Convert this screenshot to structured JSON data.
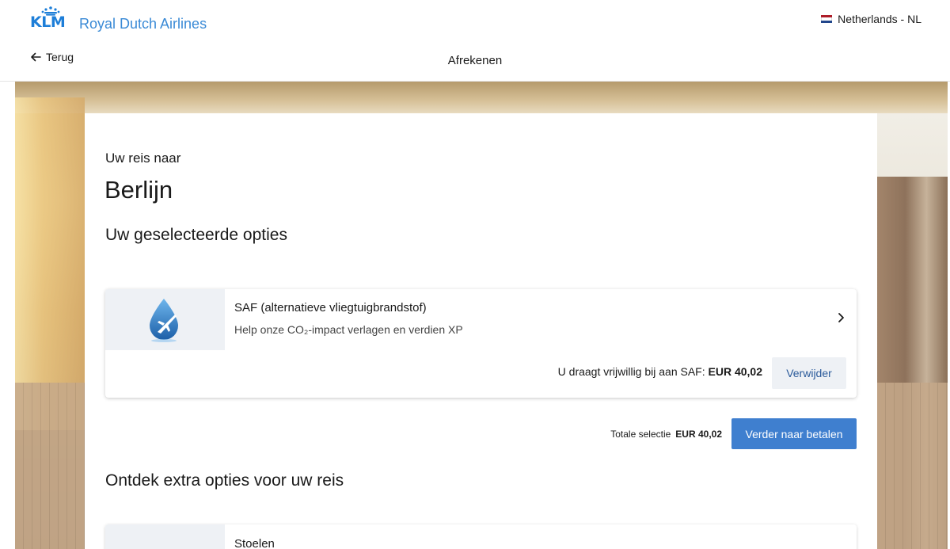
{
  "header": {
    "brand": "KLM",
    "brand_name": "Royal Dutch Airlines",
    "locale": "Netherlands - NL",
    "back_label": "Terug",
    "page_title": "Afrekenen"
  },
  "colors": {
    "brand_blue": "#1d7ed8",
    "primary_button": "#3f7fcf",
    "secondary_button_bg": "#eef1f5",
    "flag": [
      "#ae1c28",
      "#ffffff",
      "#21468b"
    ]
  },
  "trip": {
    "label": "Uw reis naar",
    "city": "Berlijn"
  },
  "selected": {
    "title": "Uw geselecteerde opties",
    "option": {
      "icon": "saf-drop-plane-icon",
      "title": "SAF (alternatieve vliegtuigbrandstof)",
      "subtitle": "Help onze CO₂-impact verlagen en verdien XP",
      "contribution_label": "U draagt vrijwillig bij aan SAF:",
      "contribution_amount": "EUR 40,02",
      "remove_label": "Verwijder"
    },
    "total_label": "Totale selectie",
    "total_amount": "EUR 40,02",
    "continue_label": "Verder naar betalen"
  },
  "extras": {
    "title": "Ontdek extra opties voor uw reis",
    "first_option_title": "Stoelen"
  }
}
